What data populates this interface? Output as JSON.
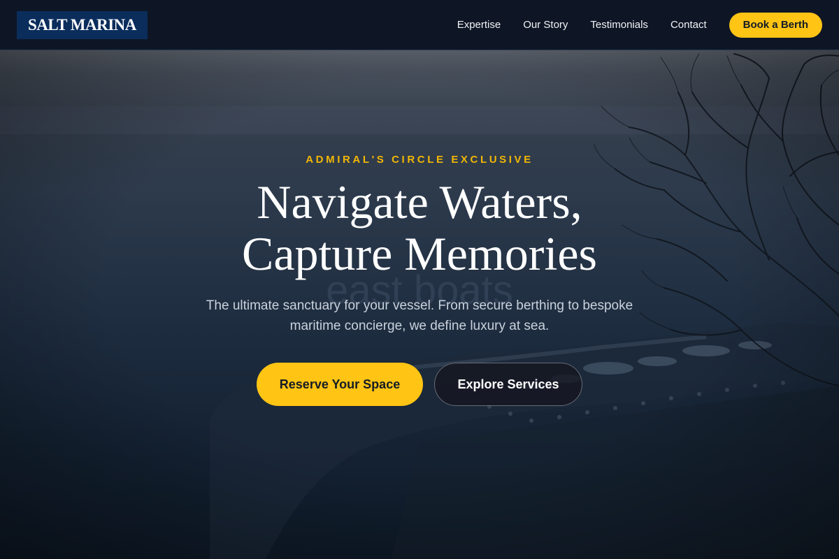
{
  "header": {
    "logo": "SALT MARINA",
    "nav": [
      {
        "label": "Expertise"
      },
      {
        "label": "Our Story"
      },
      {
        "label": "Testimonials"
      },
      {
        "label": "Contact"
      }
    ],
    "cta_label": "Book a Berth"
  },
  "hero": {
    "eyebrow": "ADMIRAL'S CIRCLE EXCLUSIVE",
    "headline_line1": "Navigate Waters,",
    "headline_line2": "Capture Memories",
    "background_text": "east boats",
    "subtext": "The ultimate sanctuary for your vessel. From secure berthing to bespoke maritime concierge, we define luxury at sea.",
    "primary_cta": "Reserve Your Space",
    "secondary_cta": "Explore Services"
  },
  "colors": {
    "accent": "#ffc414",
    "eyebrow": "#f2b705",
    "logo_bg": "#0a2d5c",
    "header_bg": "#0e1625"
  }
}
